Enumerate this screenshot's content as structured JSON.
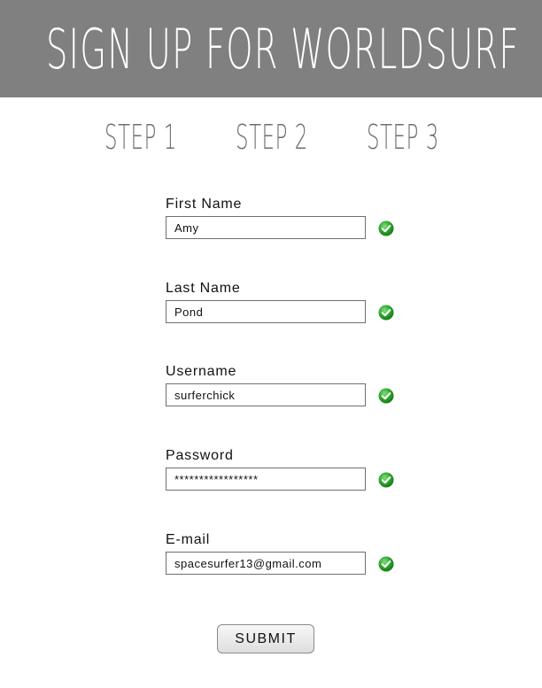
{
  "header": {
    "title": "SIGN UP FOR WORLDSURF",
    "background": "#808080"
  },
  "steps": [
    {
      "label": "STEP 1"
    },
    {
      "label": "STEP 2"
    },
    {
      "label": "STEP 3"
    }
  ],
  "form": {
    "fields": [
      {
        "label": "First Name",
        "value": "Amy",
        "valid": true
      },
      {
        "label": "Last Name",
        "value": "Pond",
        "valid": true
      },
      {
        "label": "Username",
        "value": "surferchick",
        "valid": true
      },
      {
        "label": "Password",
        "value": "*****************",
        "valid": true
      },
      {
        "label": "E-mail",
        "value": "spacesurfer13@gmail.com",
        "valid": true
      }
    ],
    "submit_label": "SUBMIT"
  },
  "colors": {
    "check_green": "#2aa52a",
    "step_text": "#6e6e6e"
  },
  "icons": {
    "valid_icon": "green-checkmark-icon"
  }
}
